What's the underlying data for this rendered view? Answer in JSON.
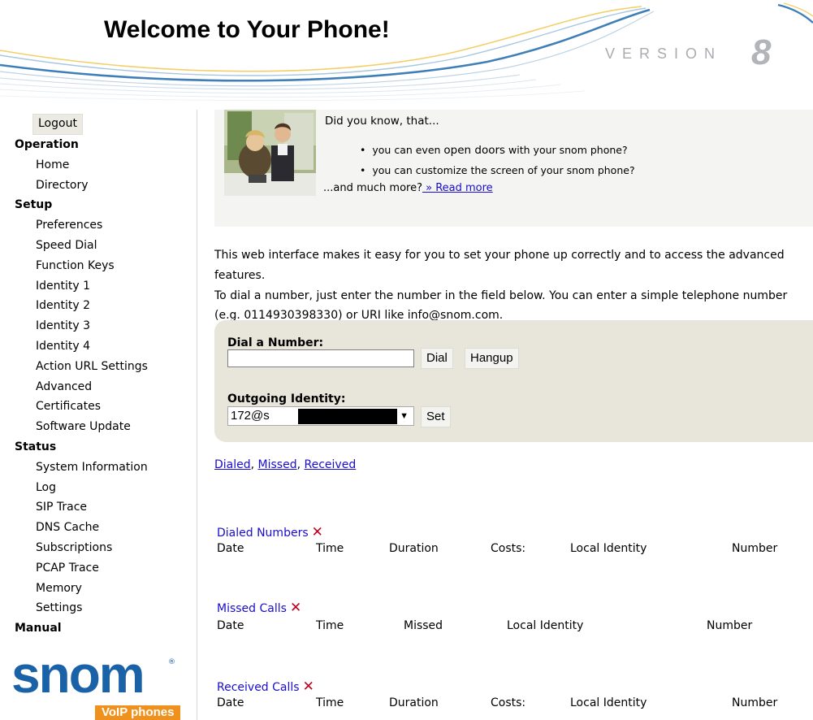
{
  "header": {
    "title": "Welcome to Your Phone!",
    "version_word": "VERSION",
    "version_num": "8"
  },
  "sidebar": {
    "logout_label": "Logout",
    "nav": [
      {
        "kind": "section",
        "label": "Operation"
      },
      {
        "kind": "item",
        "label": "Home"
      },
      {
        "kind": "item",
        "label": "Directory"
      },
      {
        "kind": "section",
        "label": "Setup"
      },
      {
        "kind": "item",
        "label": "Preferences"
      },
      {
        "kind": "item",
        "label": "Speed Dial"
      },
      {
        "kind": "item",
        "label": "Function Keys"
      },
      {
        "kind": "item",
        "label": "Identity 1"
      },
      {
        "kind": "item",
        "label": "Identity 2"
      },
      {
        "kind": "item",
        "label": "Identity 3"
      },
      {
        "kind": "item",
        "label": "Identity 4"
      },
      {
        "kind": "item",
        "label": "Action URL Settings"
      },
      {
        "kind": "item",
        "label": "Advanced"
      },
      {
        "kind": "item",
        "label": "Certificates"
      },
      {
        "kind": "item",
        "label": "Software Update"
      },
      {
        "kind": "section",
        "label": "Status"
      },
      {
        "kind": "item",
        "label": "System Information"
      },
      {
        "kind": "item",
        "label": "Log"
      },
      {
        "kind": "item",
        "label": "SIP Trace"
      },
      {
        "kind": "item",
        "label": "DNS Cache"
      },
      {
        "kind": "item",
        "label": "Subscriptions"
      },
      {
        "kind": "item",
        "label": "PCAP Trace"
      },
      {
        "kind": "item",
        "label": "Memory"
      },
      {
        "kind": "item",
        "label": "Settings"
      },
      {
        "kind": "section",
        "label": "Manual"
      }
    ],
    "logo": {
      "brand": "snom",
      "tagline": "VoIP phones"
    }
  },
  "tip": {
    "heading": "Did you know, that...",
    "bullet1_pre": "you can even ",
    "bullet1_bold": "open doors",
    "bullet1_post": " with your snom phone?",
    "bullet2": "you can customize the screen of your snom phone?",
    "more_text": "...and much more?",
    "more_link": " » Read more"
  },
  "intro": {
    "p1": "This web interface makes it easy for you to set your phone up correctly and to access the advanced features.",
    "p2": "To dial a number, just enter the number in the field below. You can enter a simple telephone number (e.g. 0114930398330) or URI like info@snom.com."
  },
  "dial": {
    "label": "Dial a Number:",
    "input_value": "",
    "dial_button": "Dial",
    "hangup_button": "Hangup",
    "identity_label": "Outgoing Identity:",
    "identity_value": "172@s",
    "set_button": "Set"
  },
  "call_links": {
    "dialed": "Dialed",
    "missed": "Missed",
    "received": "Received",
    "sep": ", "
  },
  "tables": {
    "dialed": {
      "title": "Dialed Numbers",
      "columns": [
        "Date",
        "Time",
        "Duration",
        "Costs:",
        "Local Identity",
        "Number"
      ]
    },
    "missed": {
      "title": "Missed Calls",
      "columns": [
        "Date",
        "Time",
        "Missed",
        "Local Identity",
        "Number"
      ]
    },
    "received": {
      "title": "Received Calls",
      "columns": [
        "Date",
        "Time",
        "Duration",
        "Costs:",
        "Local Identity",
        "Number"
      ]
    }
  },
  "icons": {
    "delete": "close-x-icon"
  },
  "colors": {
    "link": "#1a0dcc",
    "delete": "#c0001e",
    "snom_blue": "#1a62a8",
    "snom_orange": "#f0911d",
    "dial_box": "#e8e6da"
  }
}
